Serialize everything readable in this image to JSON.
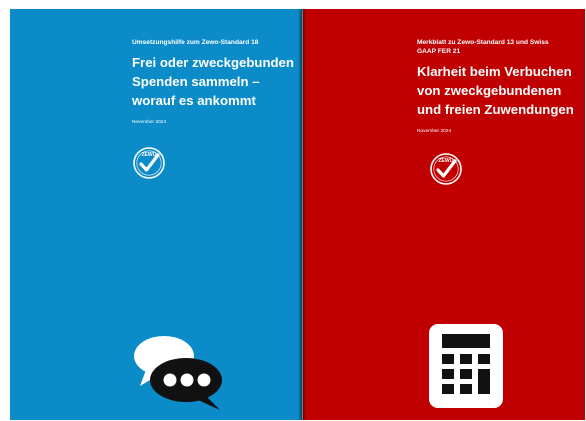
{
  "left_cover": {
    "kicker": "Umsetzungshilfe zum Zewo-Standard 18",
    "title_lines": [
      "Frei oder zweckgebunden",
      "Spenden sammeln –",
      "worauf es ankommt"
    ],
    "date": "November 2024",
    "seal_label": "ZEWO",
    "background_color": "#0b8cc9",
    "icon": "speech-bubbles-icon"
  },
  "right_cover": {
    "kicker_lines": [
      "Merkblatt zu Zewo-Standard 13 und Swiss",
      "GAAP FER 21"
    ],
    "title_lines": [
      "Klarheit beim Verbuchen",
      "von zweckgebundenen",
      "und freien Zuwendungen"
    ],
    "date": "November 2024",
    "seal_label": "ZEWO",
    "background_color": "#c00000",
    "icon": "calculator-icon"
  }
}
